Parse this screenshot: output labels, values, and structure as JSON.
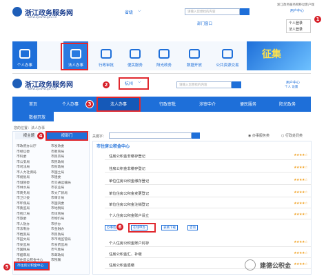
{
  "top": {
    "logo_title": "浙江政务服务网",
    "logo_sub": "www.zjzwfw.gov.cn",
    "region": "省级",
    "search_placeholder": "请输入您想找的内容",
    "util_links": "浙江政务服务网移动客户端",
    "user_center": "用户中心",
    "dept_window": "部门窗口",
    "dropdown": [
      "个人登录",
      "法人登录"
    ],
    "badge1": "1"
  },
  "tiles": [
    "个人办事",
    "法人办事",
    "行政审批",
    "便民服务",
    "阳光政务",
    "数据开放",
    "公共资源交易"
  ],
  "banner_text": "征集",
  "second": {
    "logo_title": "浙江政务服务网",
    "logo_sub": "www.zjzwfw.gov.cn",
    "region": "杭州",
    "badge2": "2",
    "search_placeholder": "请输入您想找的内容",
    "user_center": "用户中心",
    "user_links": "个人 设置"
  },
  "nav": {
    "items": [
      "首页",
      "个人办事",
      "法人办事",
      "行政审批",
      "涉审中介",
      "便民服务",
      "阳光政务",
      "数据开放"
    ],
    "badge3": "3"
  },
  "breadcrumb": "您的位置：法人办事",
  "left": {
    "tab1": "按主题",
    "tab2": "按部门",
    "badge4": "4",
    "depts": [
      "市政府办公厅",
      "市发改委",
      "市经信委",
      "市教育局",
      "市科委",
      "市民宗局",
      "市公安局",
      "市民政局",
      "市司法局",
      "市财政局",
      "市人力社保局",
      "市国土局",
      "市规划局",
      "市建委",
      "市城管委",
      "市交通运输局",
      "市林水局",
      "市农业局",
      "市商务局",
      "市文广新局",
      "市卫计委",
      "市审计局",
      "市环保局",
      "市国资委",
      "市质监局",
      "市地税局",
      "市统计局",
      "市体育局",
      "市旅委",
      "市物价局",
      "市人防办",
      "市侨办",
      "市法制办",
      "市金融办",
      "市档案局",
      "市民防局",
      "市园文局",
      "市市场监管局",
      "市安监局",
      "市食药监局",
      "市国税局",
      "市气象局",
      "市烟草局",
      "市邮政局",
      "市住房公积金中心",
      "市残联"
    ],
    "selected": "市住房公积金中心",
    "badge5": "5"
  },
  "filters": {
    "keyword_label": "关键字：",
    "option1": "办事服务类",
    "option2": "行政处罚类"
  },
  "center": {
    "title": "市住房公积金中心",
    "badge6": "6",
    "rows": [
      "住房公积金非缴存登记",
      "住房公积金非缴存登记",
      "单位住房公积金缴存登记",
      "单位住房公积金变更登记",
      "单位住房公积金注销登记",
      "个人住房公积金账户设立",
      "个人住房公积金账户封存",
      "住房公积金汇、补缴",
      "住房公积金退缴"
    ],
    "chips": [
      "办事指南",
      "在线申办",
      "表格下载",
      "咨询"
    ],
    "footer": "公众号",
    "watermark": "建德公积金"
  }
}
